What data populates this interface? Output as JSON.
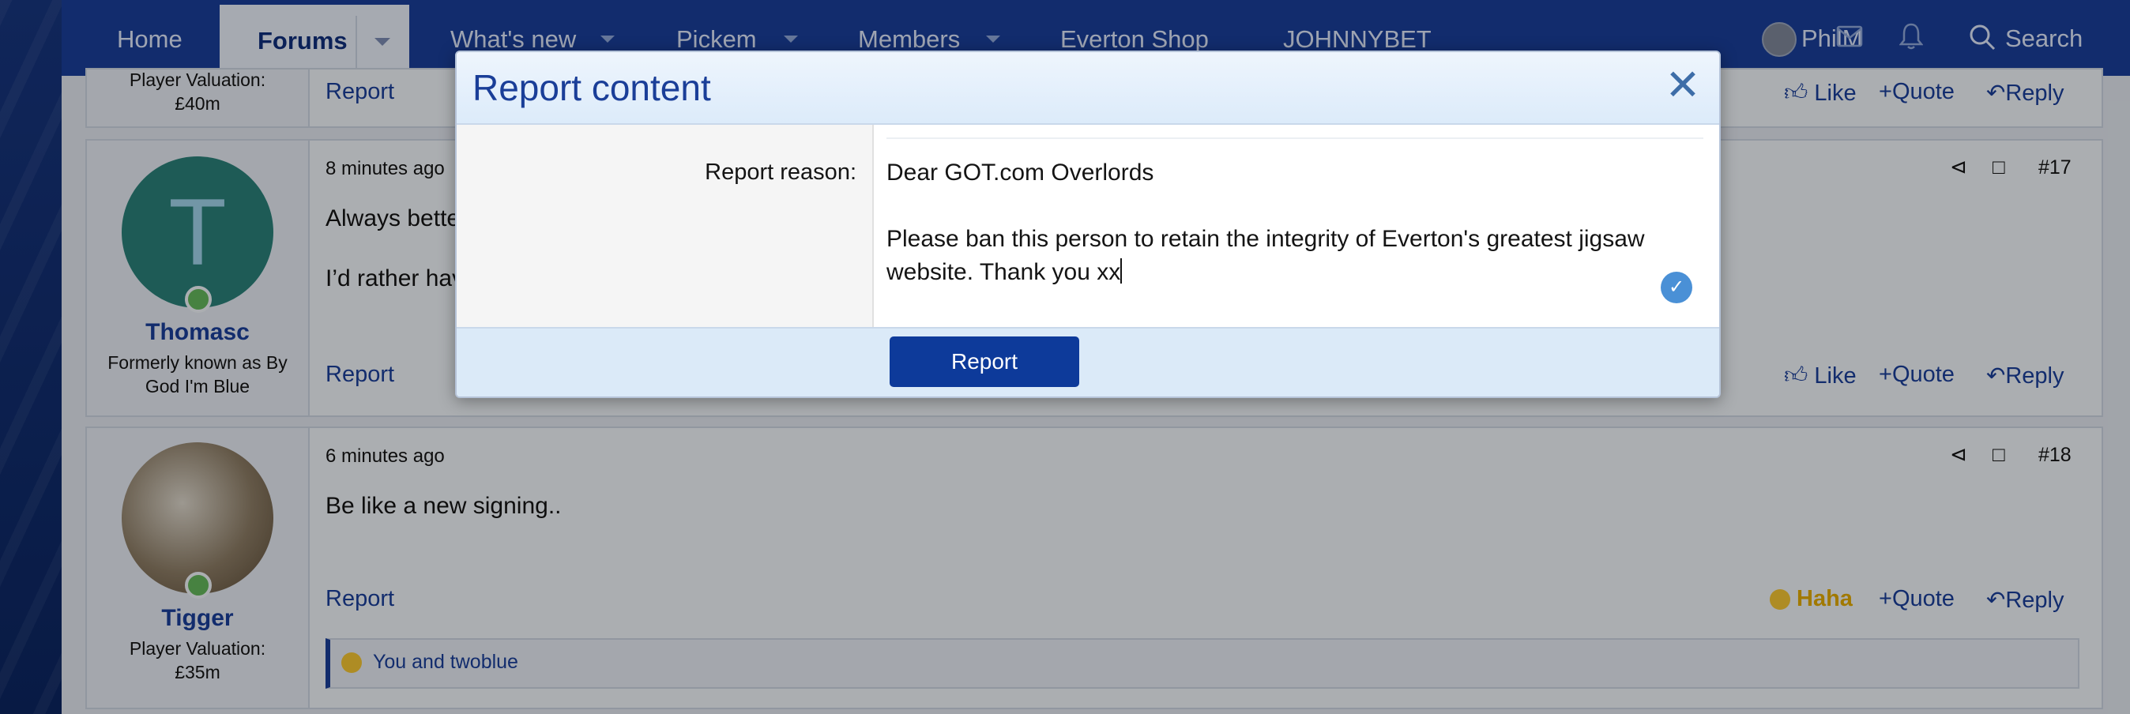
{
  "nav": {
    "home": "Home",
    "forums": "Forums",
    "whats_new": "What's new",
    "pickem": "Pickem",
    "members": "Members",
    "shop": "Everton Shop",
    "johnnybet": "JOHNNYBET",
    "username": "PhilM",
    "search": "Search"
  },
  "posts": {
    "top": {
      "valuation_line1": "Player Valuation:",
      "valuation_line2": "£40m",
      "report": "Report",
      "like": "Like",
      "quote": "Quote",
      "reply": "Reply"
    },
    "p17": {
      "time": "8 minutes ago",
      "number": "#17",
      "avatar_letter": "T",
      "avatar_color": "#2a7f78",
      "username": "Thomasc",
      "title_line1": "Formerly known as By",
      "title_line2": "God I'm Blue",
      "line1": "Always bette",
      "line2": "I’d rather hav",
      "report": "Report",
      "like": "Like",
      "quote": "Quote",
      "reply": "Reply"
    },
    "p18": {
      "time": "6 minutes ago",
      "number": "#18",
      "username": "Tigger",
      "title_line1": "Player Valuation:",
      "title_line2": "£35m",
      "text": "Be like a new signing..",
      "report": "Report",
      "reaction": "Haha",
      "quote": "Quote",
      "reply": "Reply",
      "reactions_text": "You and twoblue"
    }
  },
  "modal": {
    "title": "Report content",
    "label": "Report reason:",
    "text": "Dear GOT.com Overlords\n\nPlease ban this person to retain the integrity of Everton's greatest jigsaw\nwebsite. Thank you xx",
    "submit": "Report"
  },
  "icons": {
    "close": "close-icon",
    "check": "check-icon",
    "share": "share-icon",
    "bookmark": "bookmark-icon",
    "like": "thumbs-up-icon",
    "reply": "reply-icon",
    "mail": "envelope-icon",
    "bell": "bell-icon",
    "search": "search-icon"
  },
  "colors": {
    "brand": "#1a3e98",
    "button": "#0d3a9a",
    "haha": "#e0a800"
  }
}
